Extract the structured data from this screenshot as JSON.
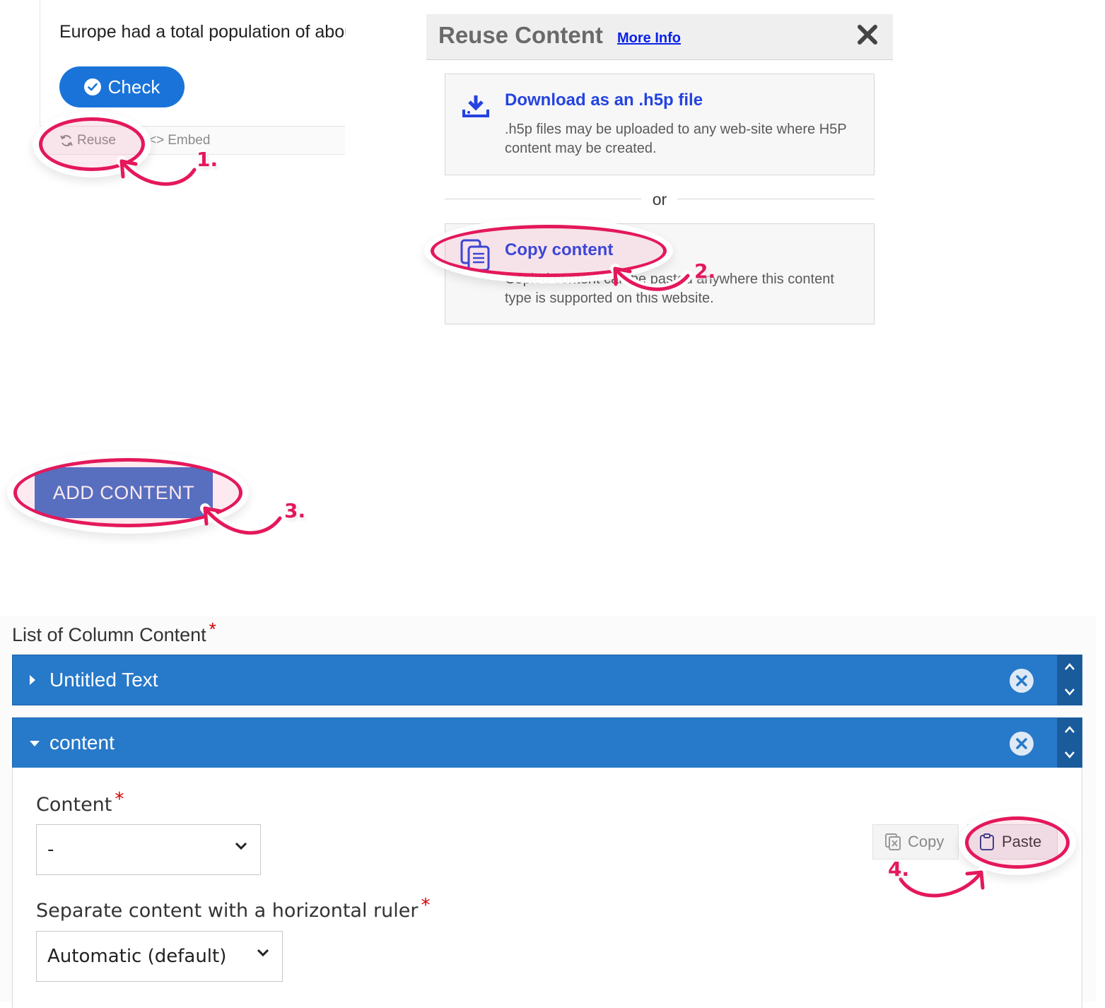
{
  "content_view": {
    "question_text": "Europe had a total population of about",
    "check_label": "Check",
    "reuse_label": "Reuse",
    "embed_label": "Embed"
  },
  "reuse_dialog": {
    "title": "Reuse Content",
    "more_info": "More Info",
    "download": {
      "title": "Download as an .h5p file",
      "description": ".h5p files may be uploaded to any web-site where H5P content may be created."
    },
    "or_text": "or",
    "copy": {
      "title": "Copy content",
      "description": "Copied content can be pasted anywhere this content type is supported on this website."
    }
  },
  "add_content_label": "ADD CONTENT",
  "editor": {
    "list_label": "List of Column Content",
    "required_mark": "*",
    "items": [
      {
        "title": "Untitled Text",
        "expanded": false
      },
      {
        "title": "content",
        "expanded": true
      }
    ],
    "content_field": {
      "label": "Content",
      "value": "-"
    },
    "copy_label": "Copy",
    "paste_label": "Paste",
    "ruler_field": {
      "label": "Separate content with a horizontal ruler",
      "value": "Automatic (default)"
    }
  },
  "steps": [
    "1.",
    "2.",
    "3.",
    "4."
  ],
  "colors": {
    "accent_blue": "#2779c9",
    "highlight": "#e4185a",
    "check_blue": "#1a73d9",
    "link_blue": "#2443e0"
  }
}
